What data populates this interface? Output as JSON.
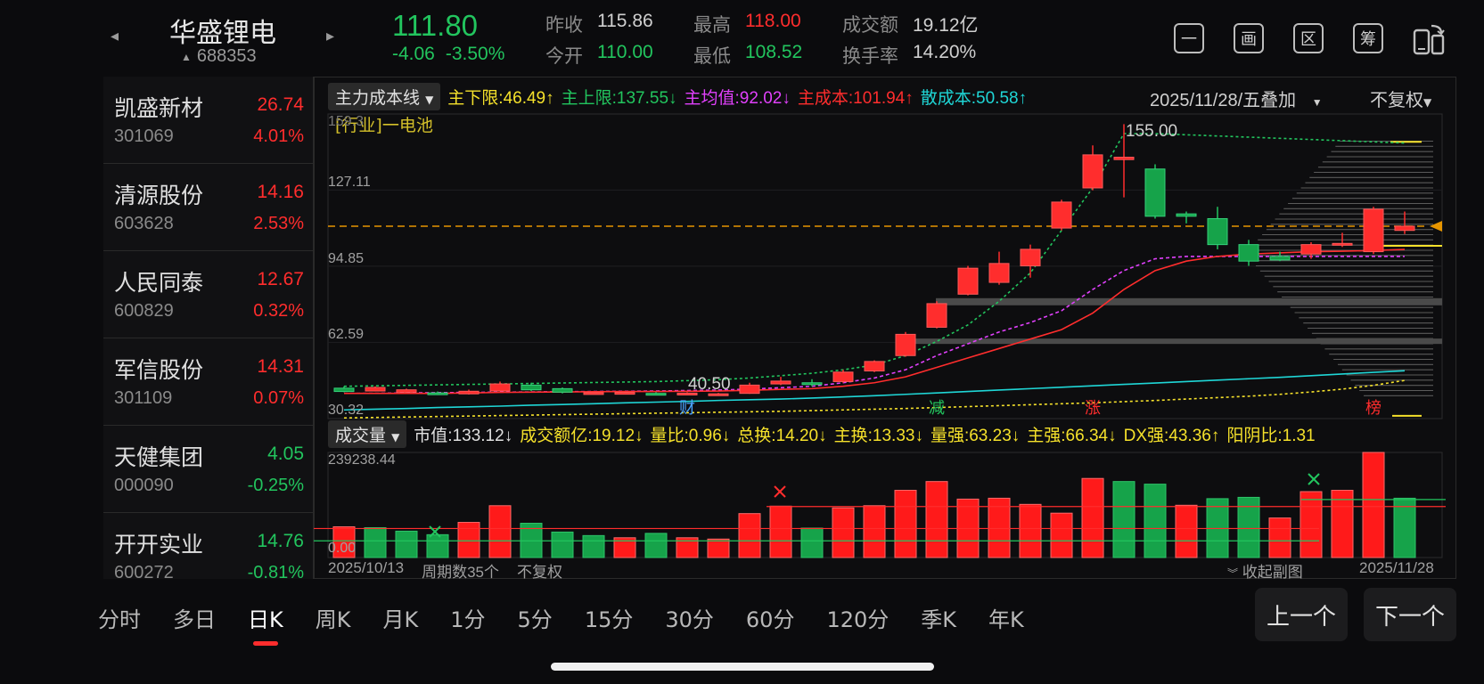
{
  "header": {
    "stock_name": "华盛锂电",
    "stock_code": "688353",
    "price": "111.80",
    "change": "-4.06",
    "change_pct": "-3.50%",
    "stats": [
      {
        "key": "昨收",
        "value": "115.86",
        "color": "#d0d0d0"
      },
      {
        "key": "今开",
        "value": "110.00",
        "color": "#22c55e"
      },
      {
        "key": "最高",
        "value": "118.00",
        "color": "#ff2d2d"
      },
      {
        "key": "最低",
        "value": "108.52",
        "color": "#22c55e"
      },
      {
        "key": "成交额",
        "value": "19.12亿",
        "color": "#d0d0d0"
      },
      {
        "key": "换手率",
        "value": "14.20%",
        "color": "#d0d0d0"
      }
    ],
    "tools": [
      "一",
      "画",
      "区",
      "筹"
    ]
  },
  "peers": [
    {
      "name": "凯盛新材",
      "code": "301069",
      "price": "26.74",
      "pct": "4.01%",
      "color": "#ff2d2d"
    },
    {
      "name": "清源股份",
      "code": "603628",
      "price": "14.16",
      "pct": "2.53%",
      "color": "#ff2d2d"
    },
    {
      "name": "人民同泰",
      "code": "600829",
      "price": "12.67",
      "pct": "0.32%",
      "color": "#ff2d2d"
    },
    {
      "name": "军信股份",
      "code": "301109",
      "price": "14.31",
      "pct": "0.07%",
      "color": "#ff2d2d"
    },
    {
      "name": "天健集团",
      "code": "000090",
      "price": "4.05",
      "pct": "-0.25%",
      "color": "#22c55e"
    },
    {
      "name": "开开实业",
      "code": "600272",
      "price": "14.76",
      "pct": "-0.81%",
      "color": "#22c55e"
    }
  ],
  "indicator": {
    "selector": "主力成本线",
    "items": [
      {
        "text": "主下限:46.49↑",
        "color": "#f5e12b"
      },
      {
        "text": "主上限:137.55↓",
        "color": "#22c55e"
      },
      {
        "text": "主均值:92.02↓",
        "color": "#e040fb"
      },
      {
        "text": "主成本:101.94↑",
        "color": "#ff2d2d"
      },
      {
        "text": "散成本:50.58↑",
        "color": "#1fd6d6"
      }
    ],
    "date": "2025/11/28/五",
    "overlay": "叠加",
    "adjust": "不复权",
    "industry": "[行业]一电池"
  },
  "axis": {
    "top_partial": "159.3",
    "y1": "127.11",
    "y2": "94.85",
    "y3": "62.59",
    "y4": "30.32",
    "peak": "155.00",
    "low": "40.50",
    "vol_max": "239238.44",
    "vol_min": "0.00"
  },
  "markers": [
    "财",
    "减",
    "涨",
    "榜"
  ],
  "volume_row": {
    "selector": "成交量",
    "items": [
      {
        "text": "市值:133.12↓",
        "color": "#e0e0e0"
      },
      {
        "text": "成交额亿:19.12↓",
        "color": "#f5e12b"
      },
      {
        "text": "量比:0.96↓",
        "color": "#f5e12b"
      },
      {
        "text": "总换:14.20↓",
        "color": "#f5e12b"
      },
      {
        "text": "主换:13.33↓",
        "color": "#f5e12b"
      },
      {
        "text": "量强:63.23↓",
        "color": "#f5e12b"
      },
      {
        "text": "主强:66.34↓",
        "color": "#f5e12b"
      },
      {
        "text": "DX强:43.36↑",
        "color": "#f5e12b"
      },
      {
        "text": "阳阴比:1.31",
        "color": "#f5e12b"
      }
    ]
  },
  "bottom": {
    "start_date": "2025/10/13",
    "period_count": "周期数35个",
    "adjust": "不复权",
    "collapse": "收起副图",
    "end_date": "2025/11/28"
  },
  "period_tabs": [
    "分时",
    "多日",
    "日K",
    "周K",
    "月K",
    "1分",
    "5分",
    "15分",
    "30分",
    "60分",
    "120分",
    "季K",
    "年K"
  ],
  "active_tab": "日K",
  "prev_label": "上一个",
  "next_label": "下一个",
  "chart_data": {
    "type": "candlestick",
    "ylim": [
      30.32,
      159.3
    ],
    "candles": [
      {
        "o": 43.2,
        "c": 41.8,
        "h": 44.0,
        "l": 41.5
      },
      {
        "o": 42.0,
        "c": 43.5,
        "h": 44.0,
        "l": 41.8
      },
      {
        "o": 41.5,
        "c": 42.5,
        "h": 43.0,
        "l": 40.8
      },
      {
        "o": 41.2,
        "c": 40.6,
        "h": 41.8,
        "l": 40.3
      },
      {
        "o": 40.8,
        "c": 41.9,
        "h": 42.6,
        "l": 40.5
      },
      {
        "o": 42.0,
        "c": 45.0,
        "h": 46.0,
        "l": 41.8
      },
      {
        "o": 44.5,
        "c": 42.5,
        "h": 45.5,
        "l": 42.0
      },
      {
        "o": 43.0,
        "c": 41.5,
        "h": 43.5,
        "l": 41.0
      },
      {
        "o": 40.8,
        "c": 41.3,
        "h": 41.8,
        "l": 40.5
      },
      {
        "o": 40.8,
        "c": 41.4,
        "h": 41.8,
        "l": 40.5
      },
      {
        "o": 41.0,
        "c": 40.5,
        "h": 41.5,
        "l": 40.3
      },
      {
        "o": 40.6,
        "c": 41.1,
        "h": 41.5,
        "l": 40.3
      },
      {
        "o": 40.3,
        "c": 40.8,
        "h": 41.2,
        "l": 40.0
      },
      {
        "o": 41.0,
        "c": 44.5,
        "h": 45.5,
        "l": 40.8
      },
      {
        "o": 45.0,
        "c": 46.2,
        "h": 48.0,
        "l": 44.5
      },
      {
        "o": 45.5,
        "c": 44.8,
        "h": 47.0,
        "l": 44.0
      },
      {
        "o": 46.0,
        "c": 50.0,
        "h": 51.0,
        "l": 45.5
      },
      {
        "o": 50.5,
        "c": 54.5,
        "h": 55.0,
        "l": 50.0
      },
      {
        "o": 57.0,
        "c": 66.0,
        "h": 67.0,
        "l": 56.5
      },
      {
        "o": 69.0,
        "c": 79.0,
        "h": 80.0,
        "l": 68.5
      },
      {
        "o": 83.0,
        "c": 94.0,
        "h": 95.0,
        "l": 82.5
      },
      {
        "o": 88.0,
        "c": 96.0,
        "h": 101.0,
        "l": 87.0
      },
      {
        "o": 95.0,
        "c": 102.0,
        "h": 104.0,
        "l": 90.0
      },
      {
        "o": 111.0,
        "c": 122.0,
        "h": 123.0,
        "l": 110.0
      },
      {
        "o": 128.0,
        "c": 142.0,
        "h": 146.0,
        "l": 127.0
      },
      {
        "o": 140.0,
        "c": 141.0,
        "h": 155.0,
        "l": 124.0
      },
      {
        "o": 136.0,
        "c": 116.0,
        "h": 138.0,
        "l": 115.0
      },
      {
        "o": 117.0,
        "c": 116.0,
        "h": 118.0,
        "l": 113.0
      },
      {
        "o": 115.0,
        "c": 104.0,
        "h": 120.0,
        "l": 102.0
      },
      {
        "o": 104.0,
        "c": 97.0,
        "h": 106.0,
        "l": 95.0
      },
      {
        "o": 99.0,
        "c": 97.5,
        "h": 101.0,
        "l": 97.0
      },
      {
        "o": 100.0,
        "c": 104.0,
        "h": 105.0,
        "l": 98.0
      },
      {
        "o": 104.0,
        "c": 104.5,
        "h": 109.0,
        "l": 103.0
      },
      {
        "o": 101.0,
        "c": 119.0,
        "h": 120.0,
        "l": 100.0
      },
      {
        "o": 110.0,
        "c": 111.8,
        "h": 118.0,
        "l": 108.5
      }
    ],
    "volume": [
      {
        "v": 70000,
        "up": true
      },
      {
        "v": 68000,
        "up": false
      },
      {
        "v": 60000,
        "up": false
      },
      {
        "v": 52000,
        "up": false
      },
      {
        "v": 80000,
        "up": true
      },
      {
        "v": 118000,
        "up": true
      },
      {
        "v": 78000,
        "up": false
      },
      {
        "v": 58000,
        "up": false
      },
      {
        "v": 50000,
        "up": false
      },
      {
        "v": 45000,
        "up": true
      },
      {
        "v": 55000,
        "up": false
      },
      {
        "v": 45000,
        "up": true
      },
      {
        "v": 42000,
        "up": true
      },
      {
        "v": 100000,
        "up": true
      },
      {
        "v": 117000,
        "up": true
      },
      {
        "v": 67000,
        "up": false
      },
      {
        "v": 113000,
        "up": true
      },
      {
        "v": 118000,
        "up": true
      },
      {
        "v": 153000,
        "up": true
      },
      {
        "v": 173000,
        "up": true
      },
      {
        "v": 133000,
        "up": true
      },
      {
        "v": 135000,
        "up": true
      },
      {
        "v": 121000,
        "up": true
      },
      {
        "v": 101000,
        "up": true
      },
      {
        "v": 180000,
        "up": true
      },
      {
        "v": 173000,
        "up": false
      },
      {
        "v": 167000,
        "up": false
      },
      {
        "v": 119000,
        "up": true
      },
      {
        "v": 134000,
        "up": false
      },
      {
        "v": 137000,
        "up": false
      },
      {
        "v": 90000,
        "up": true
      },
      {
        "v": 150000,
        "up": true
      },
      {
        "v": 153000,
        "up": true
      },
      {
        "v": 239238,
        "up": true
      },
      {
        "v": 135000,
        "up": false
      }
    ],
    "lines": {
      "main_cost": [
        41,
        41,
        41,
        41,
        41.2,
        41.4,
        41.5,
        41.6,
        41.7,
        41.8,
        41.8,
        41.9,
        42,
        42.3,
        42.7,
        43,
        44,
        45.5,
        48,
        52,
        56,
        60,
        64,
        68,
        75,
        85,
        93,
        97,
        99,
        100,
        100.5,
        101,
        101.2,
        101.5,
        101.94
      ],
      "main_avg": [
        41,
        41,
        41.2,
        41.3,
        41.4,
        41.5,
        41.6,
        41.7,
        41.8,
        41.9,
        42,
        42.2,
        42.4,
        42.8,
        43.4,
        44,
        45.5,
        47.5,
        51,
        57,
        62,
        67,
        71,
        76,
        85,
        93,
        98,
        99,
        99,
        99,
        99,
        99,
        99,
        99,
        99
      ],
      "retail_cost": [
        34,
        34.3,
        34.6,
        35,
        35.3,
        35.6,
        36,
        36.3,
        36.6,
        37,
        37.3,
        37.6,
        38,
        38.3,
        38.6,
        39,
        39.5,
        40,
        40.6,
        41.2,
        41.8,
        42.4,
        43,
        43.6,
        44.2,
        44.8,
        45.4,
        46,
        46.6,
        47.2,
        47.8,
        48.5,
        49.2,
        49.9,
        50.58
      ],
      "lower": [
        30.6,
        30.8,
        31,
        31.2,
        31.4,
        31.6,
        31.8,
        32,
        32.2,
        32.4,
        32.6,
        32.8,
        33,
        33.2,
        33.4,
        33.7,
        34,
        34.3,
        34.6,
        35,
        35.4,
        35.8,
        36.2,
        36.6,
        37,
        37.5,
        38,
        38.6,
        39.2,
        39.8,
        40.6,
        41.6,
        42.8,
        44.4,
        46.49
      ],
      "upper": [
        44,
        44.2,
        44.4,
        44.6,
        44.8,
        45,
        45.2,
        45.4,
        45.6,
        45.8,
        46,
        46.4,
        46.8,
        47.5,
        48.5,
        49.5,
        51,
        53,
        57,
        63,
        70,
        80,
        92,
        110,
        128,
        151,
        151,
        150.5,
        150,
        149.5,
        149,
        148.5,
        148,
        147.5,
        147
      ]
    }
  }
}
